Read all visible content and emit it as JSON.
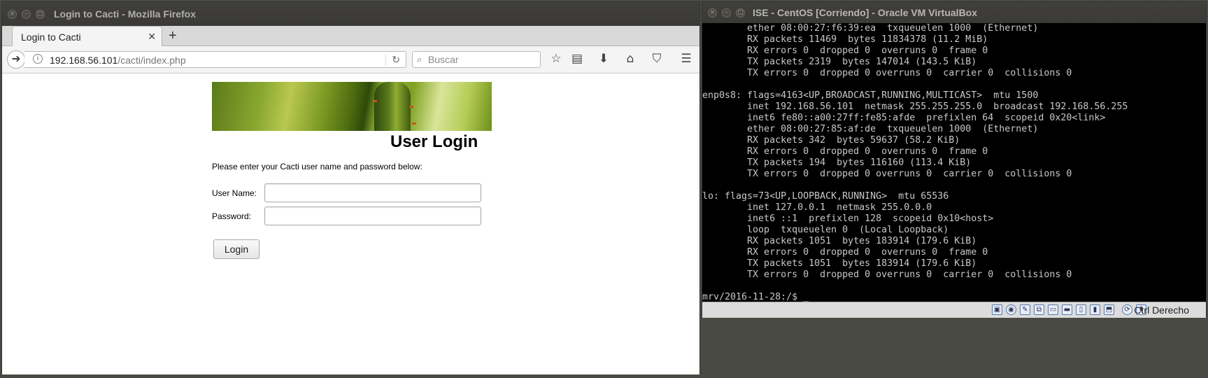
{
  "firefox": {
    "window_title": "Login to Cacti - Mozilla Firefox",
    "tab_label": "Login to Cacti",
    "url_host": "192.168.56.101",
    "url_path": "/cacti/index.php",
    "search_placeholder": "Buscar"
  },
  "cacti": {
    "title": "User Login",
    "intro": "Please enter your Cacti user name and password below:",
    "username_label": "User Name:",
    "password_label": "Password:",
    "login_button": "Login"
  },
  "vbox": {
    "window_title": "ISE - CentOS [Corriendo] - Oracle VM VirtualBox",
    "terminal_lines": [
      "        ether 08:00:27:f6:39:ea  txqueuelen 1000  (Ethernet)",
      "        RX packets 11469  bytes 11834378 (11.2 MiB)",
      "        RX errors 0  dropped 0  overruns 0  frame 0",
      "        TX packets 2319  bytes 147014 (143.5 KiB)",
      "        TX errors 0  dropped 0 overruns 0  carrier 0  collisions 0",
      "",
      "enp0s8: flags=4163<UP,BROADCAST,RUNNING,MULTICAST>  mtu 1500",
      "        inet 192.168.56.101  netmask 255.255.255.0  broadcast 192.168.56.255",
      "        inet6 fe80::a00:27ff:fe85:afde  prefixlen 64  scopeid 0x20<link>",
      "        ether 08:00:27:85:af:de  txqueuelen 1000  (Ethernet)",
      "        RX packets 342  bytes 59637 (58.2 KiB)",
      "        RX errors 0  dropped 0  overruns 0  frame 0",
      "        TX packets 194  bytes 116160 (113.4 KiB)",
      "        TX errors 0  dropped 0 overruns 0  carrier 0  collisions 0",
      "",
      "lo: flags=73<UP,LOOPBACK,RUNNING>  mtu 65536",
      "        inet 127.0.0.1  netmask 255.0.0.0",
      "        inet6 ::1  prefixlen 128  scopeid 0x10<host>",
      "        loop  txqueuelen 0  (Local Loopback)",
      "        RX packets 1051  bytes 183914 (179.6 KiB)",
      "        RX errors 0  dropped 0  overruns 0  frame 0",
      "        TX packets 1051  bytes 183914 (179.6 KiB)",
      "        TX errors 0  dropped 0 overruns 0  carrier 0  collisions 0",
      "",
      "mrv/2016-11-28:/$ _"
    ],
    "host_key_label": "Ctrl Derecho"
  },
  "icons": [
    "close-icon",
    "minimize-icon",
    "maximize-icon",
    "back-icon",
    "info-icon",
    "reload-icon",
    "search-icon",
    "bookmark-star-icon",
    "reading-list-icon",
    "download-icon",
    "home-icon",
    "pocket-icon",
    "menu-icon"
  ]
}
